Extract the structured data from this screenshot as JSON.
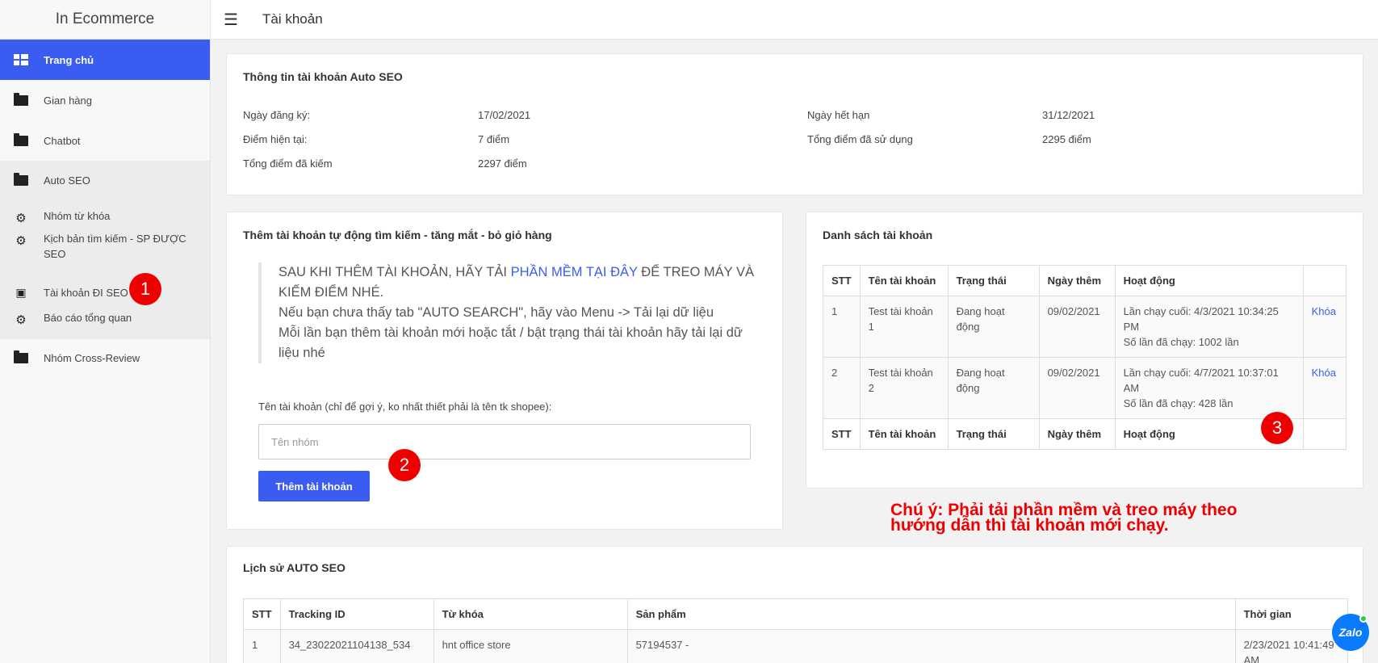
{
  "brand": "In Ecommerce",
  "topbar": {
    "title": "Tài khoản"
  },
  "sidebar": {
    "items": [
      {
        "label": "Trang chủ",
        "icon": "dashboard-icon"
      },
      {
        "label": "Gian hàng",
        "icon": "folder-icon"
      },
      {
        "label": "Chatbot",
        "icon": "folder-icon"
      },
      {
        "label": "Auto SEO",
        "icon": "folder-icon"
      },
      {
        "label": "Nhóm từ khóa",
        "icon": "gear-icon"
      },
      {
        "label": "Kịch bản tìm kiếm - SP ĐƯỢC SEO",
        "icon": "gear-icon"
      },
      {
        "label": "Tài khoản ĐI SEO",
        "icon": "calendar-icon"
      },
      {
        "label": "Báo cáo tổng quan",
        "icon": "gear-icon"
      },
      {
        "label": "Nhóm Cross-Review",
        "icon": "folder-icon"
      }
    ]
  },
  "account_info": {
    "title": "Thông tin tài khoản Auto SEO",
    "registered_label": "Ngày đăng ký:",
    "registered_value": "17/02/2021",
    "current_points_label": "Điểm hiện tại:",
    "current_points_value": "7 điểm",
    "earned_label": "Tổng điểm đã kiếm",
    "earned_value": "2297 điểm",
    "expire_label": "Ngày hết hạn",
    "expire_value": "31/12/2021",
    "used_label": "Tổng điểm đã sử dụng",
    "used_value": "2295 điểm"
  },
  "add_account": {
    "title": "Thêm tài khoản tự động tìm kiếm - tăng mắt - bỏ giỏ hàng",
    "notice_prefix": "SAU KHI THÊM TÀI KHOẢN, HÃY TẢI ",
    "notice_link": "PHẦN MỀM TẠI ĐÂY",
    "notice_suffix": " ĐỂ TREO MÁY VÀ KIẾM ĐIỂM NHÉ.",
    "notice_line2": "Nếu bạn chưa thấy tab \"AUTO SEARCH\", hãy vào Menu -> Tải lại dữ liệu",
    "notice_line3": "Mỗi lần bạn thêm tài khoản mới hoặc tắt / bật trạng thái tài khoản hãy tải lại dữ liệu nhé",
    "field_label": "Tên tài khoản (chỉ để gợi ý, ko nhất thiết phải là tên tk shopee):",
    "field_placeholder": "Tên nhóm",
    "button_label": "Thêm tài khoản"
  },
  "account_list": {
    "title": "Danh sách tài khoản",
    "columns": [
      "STT",
      "Tên tài khoản",
      "Trạng thái",
      "Ngày thêm",
      "Hoạt động",
      ""
    ],
    "rows": [
      {
        "stt": "1",
        "name": "Test tài khoản 1",
        "status": "Đang hoạt động",
        "date": "09/02/2021",
        "last_run": "Lần chạy cuối: 4/3/2021 10:34:25 PM",
        "run_count": "Số lần đã chạy: 1002 lần",
        "action": "Khóa"
      },
      {
        "stt": "2",
        "name": "Test tài khoản 2",
        "status": "Đang hoạt động",
        "date": "09/02/2021",
        "last_run": "Lần chạy cuối: 4/7/2021 10:37:01 AM",
        "run_count": "Số lần đã chạy: 428 lần",
        "action": "Khóa"
      }
    ]
  },
  "history": {
    "title": "Lịch sử AUTO SEO",
    "columns": [
      "STT",
      "Tracking ID",
      "Từ khóa",
      "Sản phẩm",
      "Thời gian"
    ],
    "rows": [
      {
        "stt": "1",
        "tracking_id": "34_23022021104138_534",
        "keyword": "hnt office store",
        "product": "57194537 -",
        "time": "2/23/2021 10:41:49 AM"
      }
    ]
  },
  "annotations": {
    "badge1": "1",
    "badge2": "2",
    "badge3": "3",
    "note_line1": "Chú ý: Phải tải phần mềm và treo máy theo",
    "note_line2": "hướng dẫn thì tài khoản mới chạy."
  },
  "zalo": "Zalo",
  "colors": {
    "accent": "#3b5cf0",
    "annotation": "#e00000"
  }
}
